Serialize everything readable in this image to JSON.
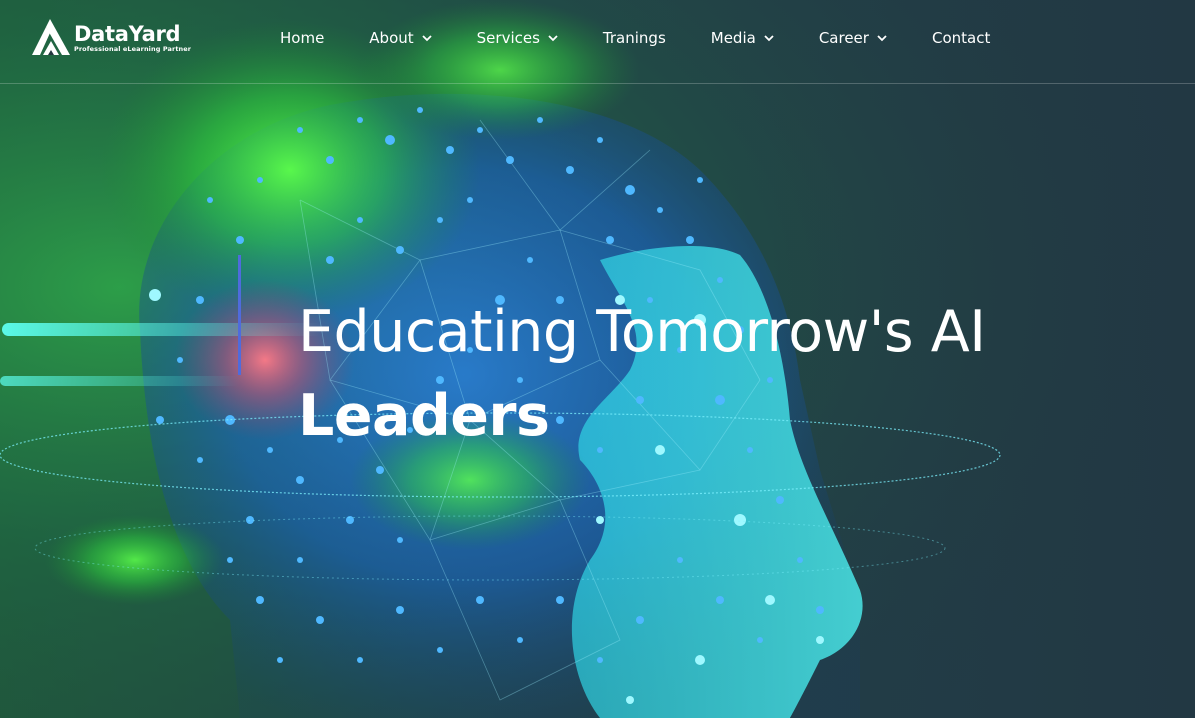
{
  "brand": {
    "name": "DataYard",
    "tagline": "Professional eLearning Partner"
  },
  "nav": {
    "items": [
      {
        "label": "Home",
        "has_dropdown": false
      },
      {
        "label": "About",
        "has_dropdown": true
      },
      {
        "label": "Services",
        "has_dropdown": true
      },
      {
        "label": "Tranings",
        "has_dropdown": false
      },
      {
        "label": "Media",
        "has_dropdown": true
      },
      {
        "label": "Career",
        "has_dropdown": true
      },
      {
        "label": "Contact",
        "has_dropdown": false
      }
    ]
  },
  "hero": {
    "title_line1": "Educating Tomorrow's AI",
    "title_line2": "Leaders",
    "image_icon": "ai-head-illustration"
  },
  "colors": {
    "accent_line": "#4f6bdd",
    "text": "#ffffff",
    "background": "#22363e",
    "glow_green": "#3fe04a",
    "glow_cyan": "#35e6e6",
    "dots_blue": "#2f8cff"
  }
}
